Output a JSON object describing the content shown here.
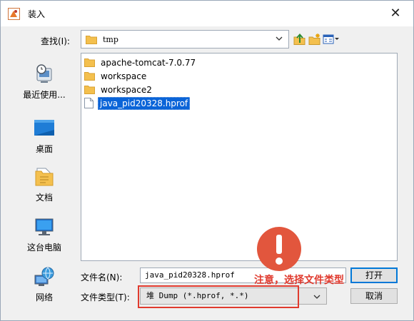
{
  "window": {
    "title": "装入",
    "close_glyph": "✕"
  },
  "look_in": {
    "label": "查找(I):",
    "value": "tmp",
    "icon": "folder-icon"
  },
  "toolbar": {
    "buttons": [
      "up-one-level-icon",
      "new-folder-icon",
      "view-menu-icon"
    ]
  },
  "places": [
    {
      "label": "最近使用...",
      "icon": "recent-items-icon"
    },
    {
      "label": "桌面",
      "icon": "desktop-icon"
    },
    {
      "label": "文档",
      "icon": "documents-icon"
    },
    {
      "label": "这台电脑",
      "icon": "this-pc-icon"
    },
    {
      "label": "网络",
      "icon": "network-icon"
    }
  ],
  "files": [
    {
      "name": "apache-tomcat-7.0.77",
      "type": "folder"
    },
    {
      "name": "workspace",
      "type": "folder"
    },
    {
      "name": "workspace2",
      "type": "folder"
    },
    {
      "name": "java_pid20328.hprof",
      "type": "file",
      "selected": true
    }
  ],
  "file_name": {
    "label": "文件名(N):",
    "value": "java_pid20328.hprof"
  },
  "file_type": {
    "label": "文件类型(T):",
    "value": "堆 Dump (*.hprof, *.*)"
  },
  "buttons": {
    "open": "打开",
    "cancel": "取消"
  },
  "annotation": {
    "note": "注意，选择文件类型",
    "color": "#e03a2e"
  },
  "colors": {
    "selection": "#0a64d8",
    "folder": "#f4c04e",
    "accent": "#0078d7"
  }
}
